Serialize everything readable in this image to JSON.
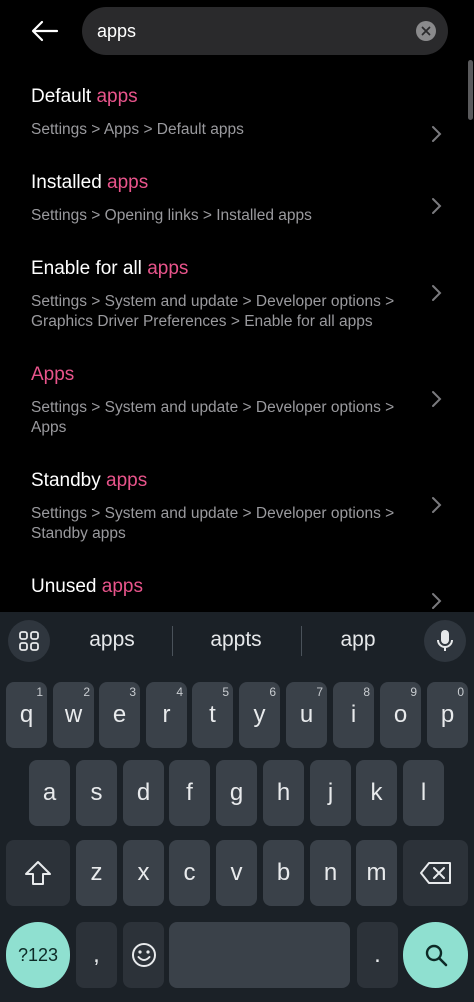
{
  "search": {
    "query": "apps"
  },
  "results": [
    {
      "prefix": "Default ",
      "match": "apps",
      "suffix": "",
      "path": "Settings > Apps > Default apps"
    },
    {
      "prefix": "Installed ",
      "match": "apps",
      "suffix": "",
      "path": "Settings > Opening links > Installed apps"
    },
    {
      "prefix": "Enable for all ",
      "match": "apps",
      "suffix": "",
      "path": "Settings > System and update > Developer options > Graphics Driver Preferences > Enable for all apps"
    },
    {
      "prefix": "",
      "match": "Apps",
      "suffix": "",
      "path": "Settings > System and update > Developer options > Apps"
    },
    {
      "prefix": "Standby ",
      "match": "apps",
      "suffix": "",
      "path": "Settings > System and update > Developer options > Standby apps"
    },
    {
      "prefix": "Unused ",
      "match": "apps",
      "suffix": "",
      "path": ""
    }
  ],
  "keyboard": {
    "suggestions": [
      "apps",
      "appts",
      "app"
    ],
    "row1": [
      {
        "k": "q",
        "n": "1"
      },
      {
        "k": "w",
        "n": "2"
      },
      {
        "k": "e",
        "n": "3"
      },
      {
        "k": "r",
        "n": "4"
      },
      {
        "k": "t",
        "n": "5"
      },
      {
        "k": "y",
        "n": "6"
      },
      {
        "k": "u",
        "n": "7"
      },
      {
        "k": "i",
        "n": "8"
      },
      {
        "k": "o",
        "n": "9"
      },
      {
        "k": "p",
        "n": "0"
      }
    ],
    "row2": [
      "a",
      "s",
      "d",
      "f",
      "g",
      "h",
      "j",
      "k",
      "l"
    ],
    "row3": [
      "z",
      "x",
      "c",
      "v",
      "b",
      "n",
      "m"
    ],
    "symbols_label": "?123",
    "comma": ",",
    "period": "."
  },
  "colors": {
    "highlight": "#e8548b",
    "action_key": "#8fe0d0",
    "keyboard_bg": "#1b2127"
  }
}
